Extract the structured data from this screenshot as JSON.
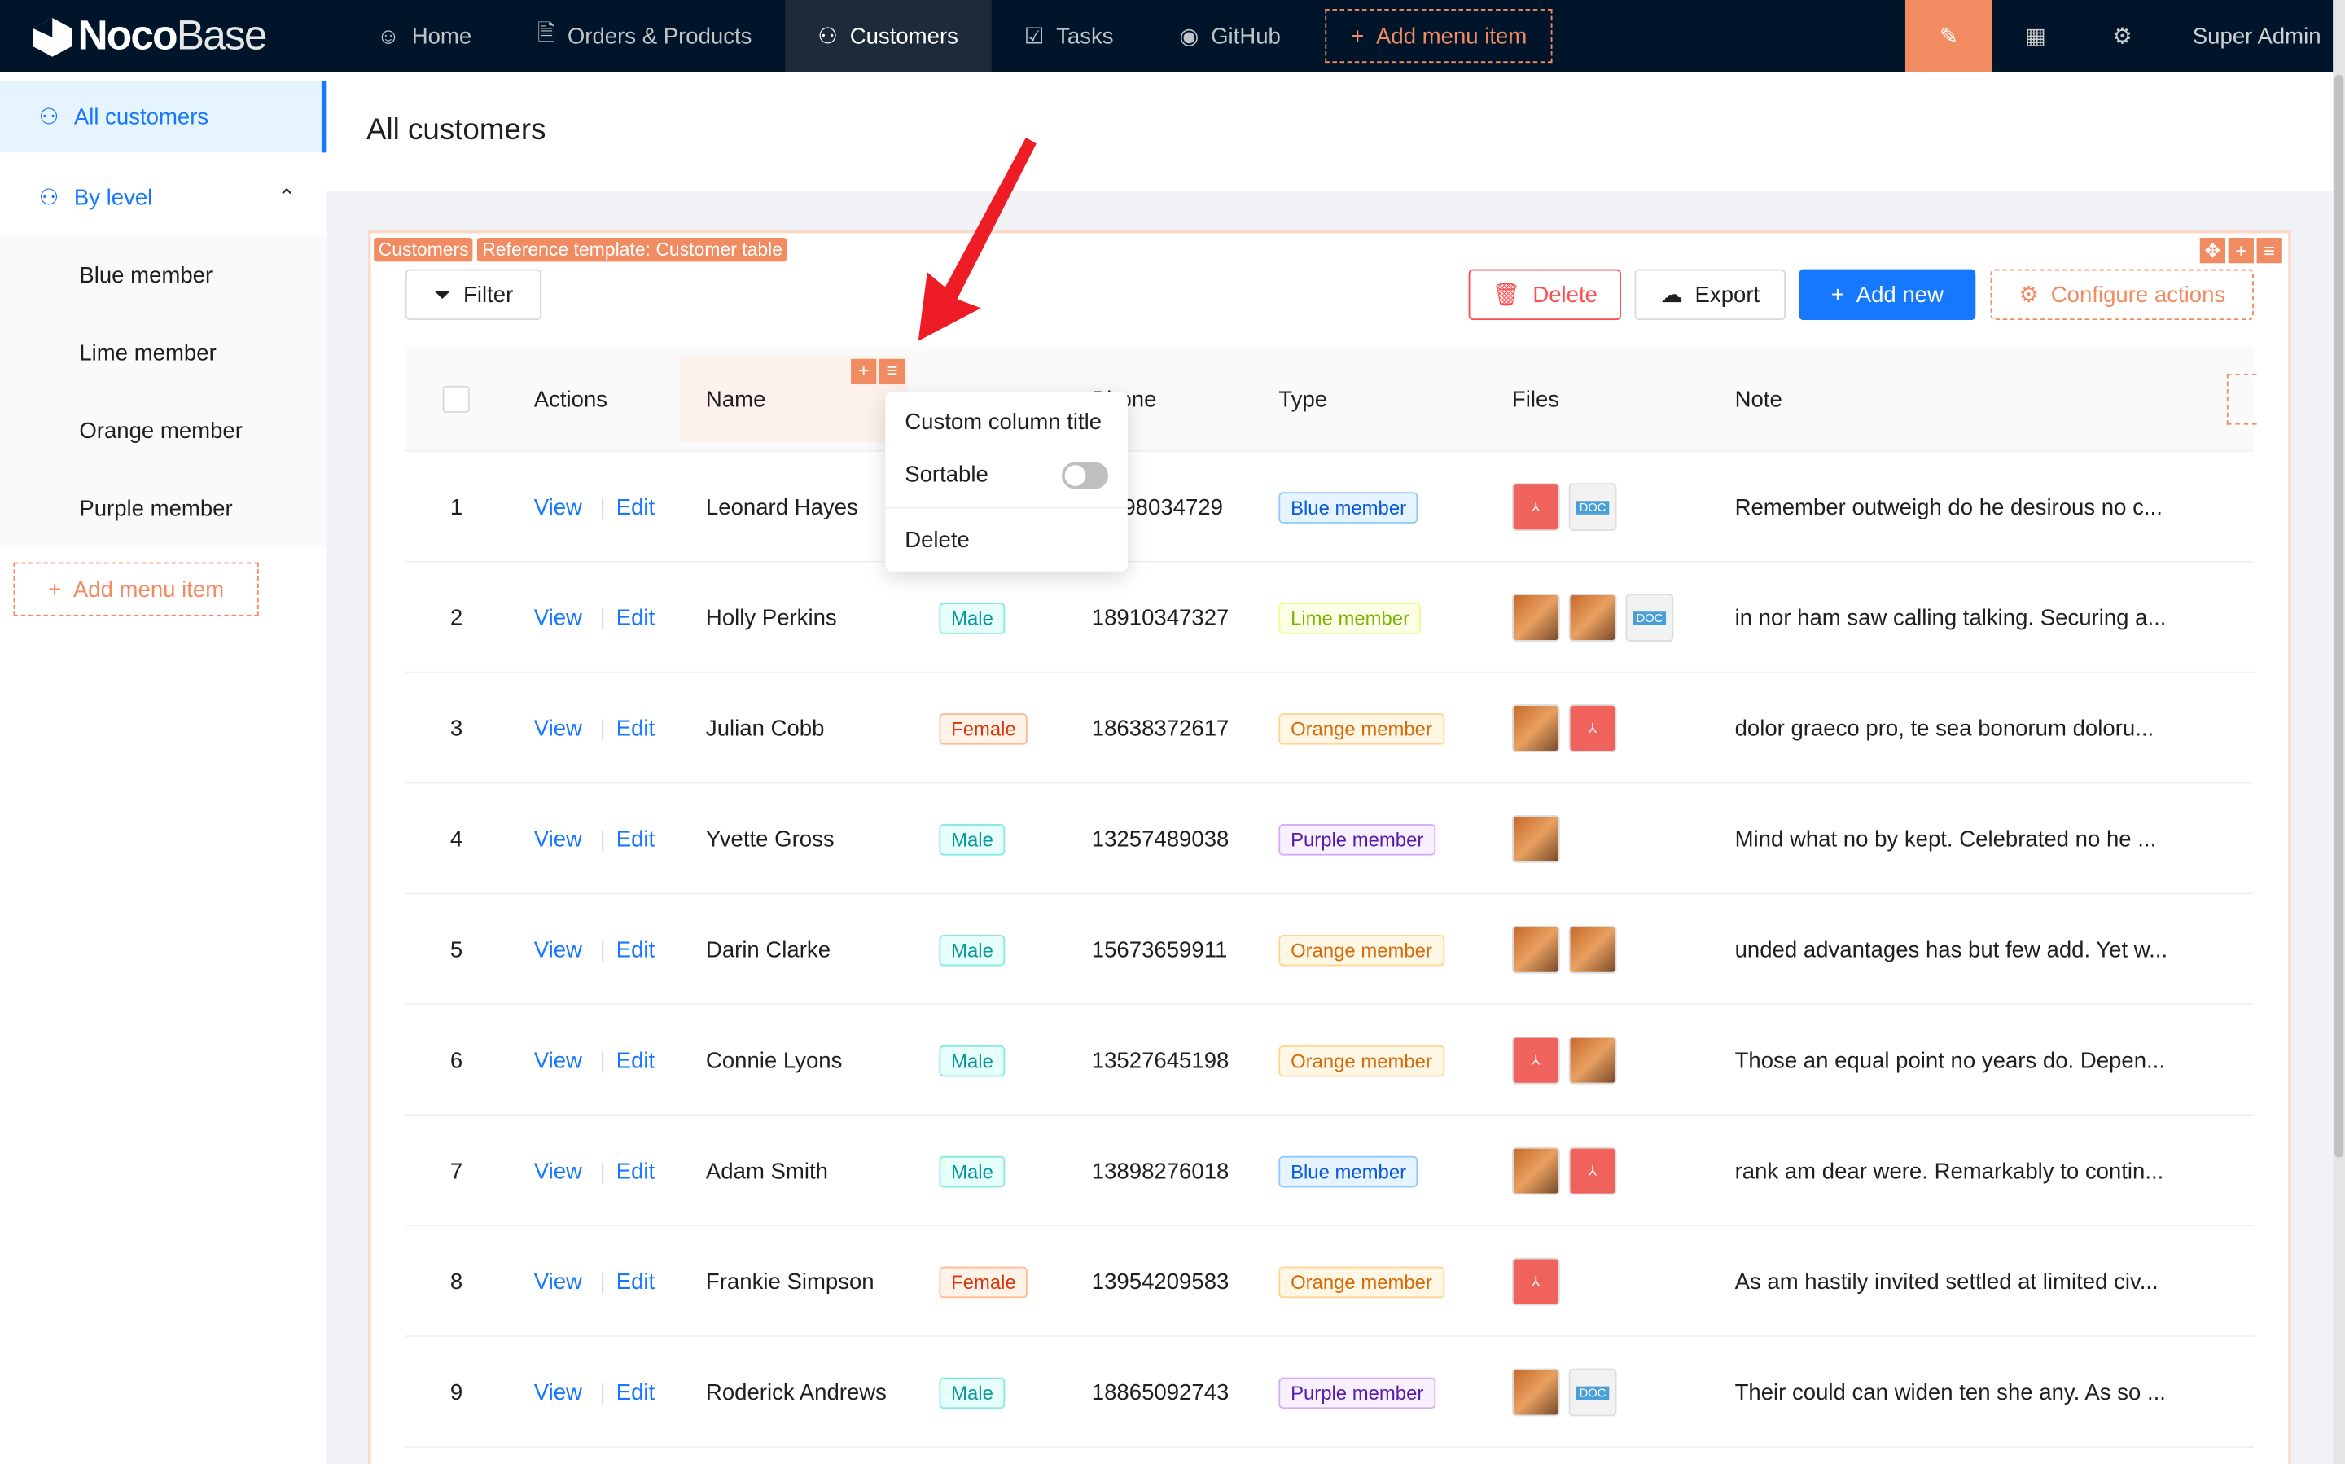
{
  "top": {
    "logo": "NocoBase",
    "logo_bold": "Noco",
    "logo_light": "Base",
    "nav": [
      {
        "label": "Home",
        "icon": "smile-icon"
      },
      {
        "label": "Orders & Products",
        "icon": "file-check-icon"
      },
      {
        "label": "Customers",
        "icon": "users-icon",
        "active": true
      },
      {
        "label": "Tasks",
        "icon": "checkbox-icon"
      },
      {
        "label": "GitHub",
        "icon": "github-icon"
      }
    ],
    "add_menu": "Add menu item",
    "user": "Super Admin"
  },
  "sidebar": {
    "items": [
      {
        "label": "All customers",
        "active": true
      },
      {
        "label": "By level",
        "expanded": true
      }
    ],
    "sub": [
      "Blue member",
      "Lime member",
      "Orange member",
      "Purple member"
    ],
    "add_menu": "Add menu item"
  },
  "page": {
    "title": "All customers"
  },
  "block": {
    "tags": [
      "Customers",
      "Reference template: Customer table"
    ],
    "filter": "Filter",
    "delete": "Delete",
    "export": "Export",
    "add_new": "Add new",
    "configure": "Configure actions"
  },
  "table": {
    "columns": [
      "Actions",
      "Name",
      "Phone",
      "Type",
      "Files",
      "Note"
    ],
    "phone_visible": "one",
    "view": "View",
    "edit": "Edit",
    "rows": [
      {
        "n": "1",
        "name": "Leonard Hayes",
        "gender": "",
        "phone": "98034729",
        "type": "Blue member",
        "files": [
          "pdf",
          "doc"
        ],
        "note": "Remember outweigh do he desirous no c..."
      },
      {
        "n": "2",
        "name": "Holly Perkins",
        "gender": "Male",
        "phone": "18910347327",
        "type": "Lime member",
        "files": [
          "img",
          "img",
          "doc"
        ],
        "note": "in nor ham saw calling talking. Securing a..."
      },
      {
        "n": "3",
        "name": "Julian Cobb",
        "gender": "Female",
        "phone": "18638372617",
        "type": "Orange member",
        "files": [
          "img",
          "pdf"
        ],
        "note": "dolor graeco pro, te sea bonorum doloru..."
      },
      {
        "n": "4",
        "name": "Yvette Gross",
        "gender": "Male",
        "phone": "13257489038",
        "type": "Purple member",
        "files": [
          "img"
        ],
        "note": "Mind what no by kept. Celebrated no he ..."
      },
      {
        "n": "5",
        "name": "Darin Clarke",
        "gender": "Male",
        "phone": "15673659911",
        "type": "Orange member",
        "files": [
          "img",
          "img"
        ],
        "note": "unded advantages has but few add. Yet w..."
      },
      {
        "n": "6",
        "name": "Connie Lyons",
        "gender": "Male",
        "phone": "13527645198",
        "type": "Orange member",
        "files": [
          "pdf",
          "img"
        ],
        "note": "Those an equal point no years do. Depen..."
      },
      {
        "n": "7",
        "name": "Adam Smith",
        "gender": "Male",
        "phone": "13898276018",
        "type": "Blue member",
        "files": [
          "img",
          "pdf"
        ],
        "note": "rank am dear were. Remarkably to contin..."
      },
      {
        "n": "8",
        "name": "Frankie Simpson",
        "gender": "Female",
        "phone": "13954209583",
        "type": "Orange member",
        "files": [
          "pdf"
        ],
        "note": "As am hastily invited settled at limited civ..."
      },
      {
        "n": "9",
        "name": "Roderick Andrews",
        "gender": "Male",
        "phone": "18865092743",
        "type": "Purple member",
        "files": [
          "img",
          "doc"
        ],
        "note": "Their could can widen ten she any. As so ..."
      }
    ]
  },
  "column_menu": {
    "items": [
      "Custom column title",
      "Sortable",
      "Delete"
    ],
    "sortable": false
  },
  "colors": {
    "accent": "#1677ff",
    "design": "#f18b62",
    "danger": "#ff4d4f",
    "nav_bg": "#001529"
  }
}
